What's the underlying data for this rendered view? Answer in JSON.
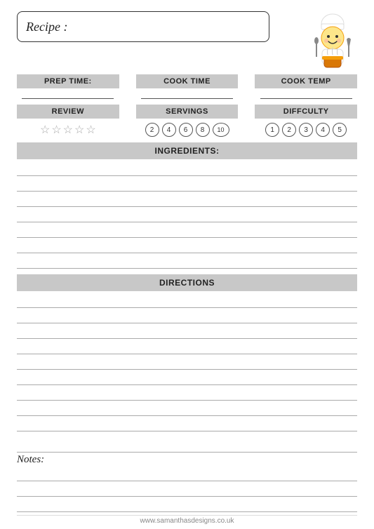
{
  "header": {
    "recipe_label": "Recipe :"
  },
  "prep_time": {
    "label": "PREP TIME:"
  },
  "cook_time": {
    "label": "COOK TIME"
  },
  "cook_temp": {
    "label": "COOK TEMP"
  },
  "review": {
    "label": "REVIEW"
  },
  "servings": {
    "label": "SERVINGS",
    "options": [
      "2",
      "4",
      "6",
      "8",
      "10"
    ]
  },
  "difficulty": {
    "label": "DIFFCULTY",
    "options": [
      "1",
      "2",
      "3",
      "4",
      "5"
    ]
  },
  "ingredients": {
    "label": "INGREDIENTS:"
  },
  "directions": {
    "label": "DIRECTIONS"
  },
  "notes": {
    "label": "Notes:"
  },
  "footer": {
    "url": "www.samanthasdesigns.co.uk"
  }
}
